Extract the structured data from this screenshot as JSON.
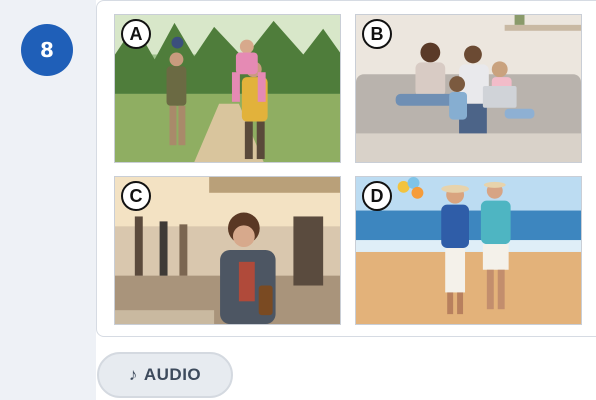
{
  "question": {
    "number": "8"
  },
  "options": [
    {
      "letter": "A",
      "scene": "family-hiking-photo"
    },
    {
      "letter": "B",
      "scene": "family-on-sofa-with-laptop-photo"
    },
    {
      "letter": "C",
      "scene": "woman-at-street-cafe-photo"
    },
    {
      "letter": "D",
      "scene": "couple-walking-on-beach-photo"
    }
  ],
  "audio": {
    "icon": "music-note-icon",
    "glyph": "♪",
    "label": "AUDIO"
  },
  "colors": {
    "badge": "#1f5fb8",
    "rail": "#eef1f6",
    "audio_bg": "#e7ebf0"
  }
}
